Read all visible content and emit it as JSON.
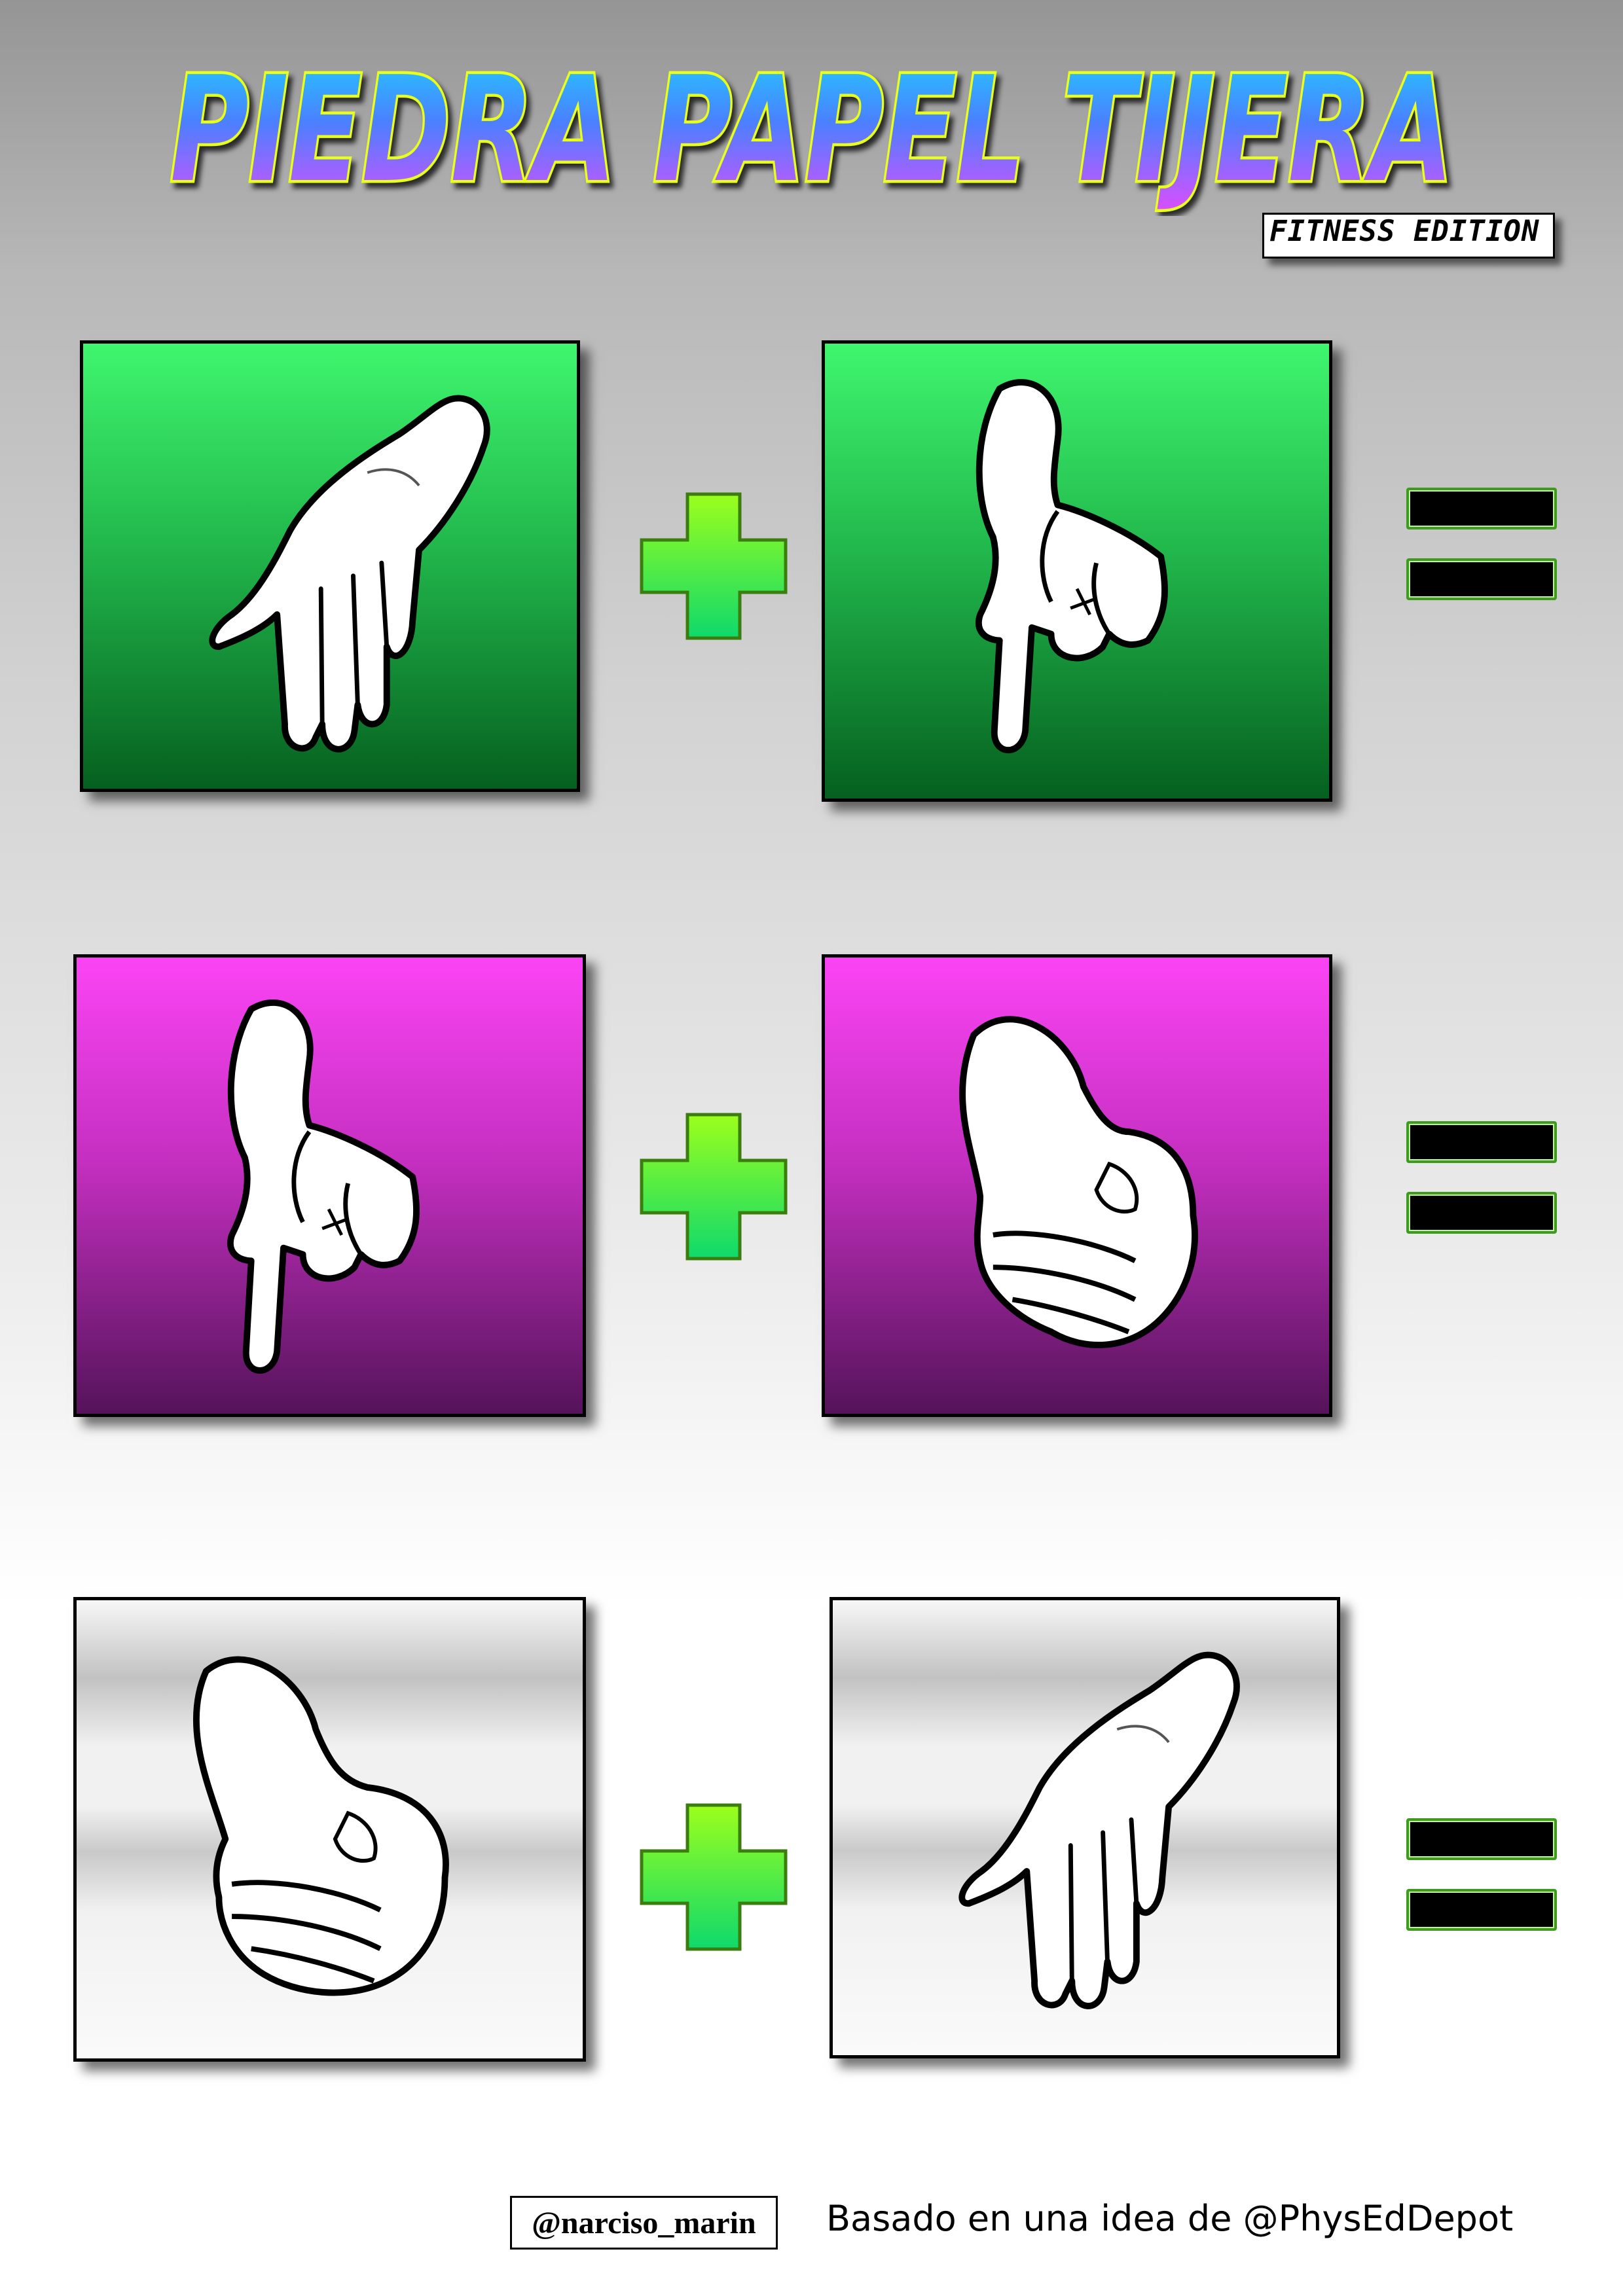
{
  "title": {
    "main": "PIEDRA PAPEL TIJERA",
    "subtitle": "FITNESS EDITION"
  },
  "rows": [
    {
      "color": "green",
      "left_gesture": "paper-hand-icon",
      "operator": "plus-icon",
      "right_gesture": "scissors-hand-icon",
      "result": "equals-icon"
    },
    {
      "color": "magenta",
      "left_gesture": "scissors-hand-icon",
      "operator": "plus-icon",
      "right_gesture": "rock-hand-icon",
      "result": "equals-icon"
    },
    {
      "color": "grey",
      "left_gesture": "rock-hand-icon",
      "operator": "plus-icon",
      "right_gesture": "paper-hand-icon",
      "result": "equals-icon"
    }
  ],
  "colors": {
    "green_top": "#3ff66e",
    "green_bottom": "#05601f",
    "magenta_top": "#fb44f5",
    "magenta_bottom": "#55135a",
    "grey": "#c2c2c2",
    "plus_top": "#9cff1c",
    "plus_bottom": "#0ed96c",
    "equals_border": "#3e9b1f"
  },
  "footer": {
    "handle": "@narciso_marin",
    "credit": "Basado en una idea de @PhysEdDepot"
  }
}
